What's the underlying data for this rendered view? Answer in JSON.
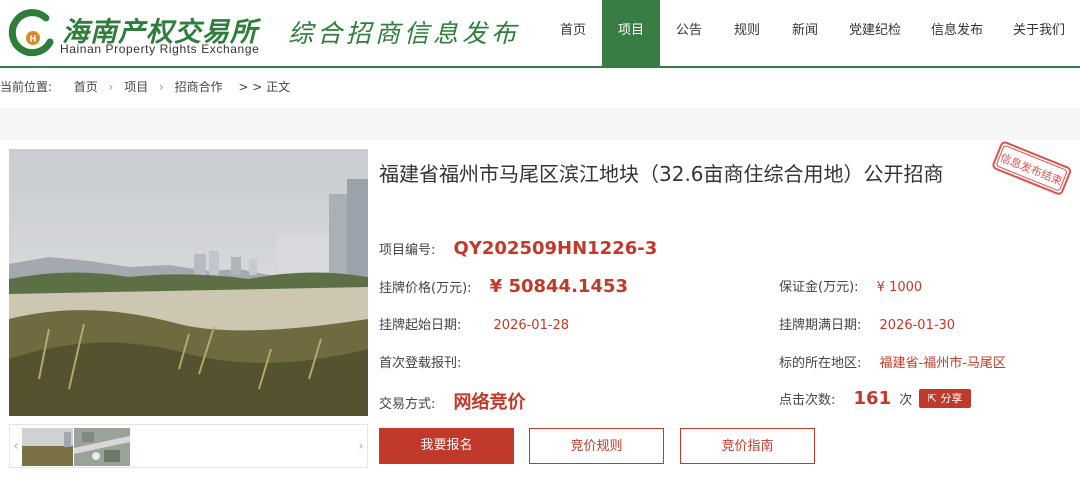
{
  "header": {
    "logo_cn": "海南产权交易所",
    "logo_en": "Hainan Property Rights Exchange",
    "slogan": "综合招商信息发布",
    "nav": [
      "首页",
      "项目",
      "公告",
      "规则",
      "新闻",
      "党建纪检",
      "信息发布",
      "关于我们"
    ],
    "nav_active_index": 1
  },
  "breadcrumb": {
    "prefix": "当前位置:",
    "items": [
      "首页",
      "项目",
      "招商合作"
    ],
    "tail": "> > 正文"
  },
  "project": {
    "title": "福建省福州市马尾区滨江地块（32.6亩商住综合用地）公开招商",
    "stamp_text": "信息发布结束",
    "code_label": "项目编号:",
    "code_value": "QY202509HN1226-3",
    "price_label": "挂牌价格(万元):",
    "price_value": "¥  50844.1453",
    "deposit_label": "保证金(万元):",
    "deposit_value": "¥ 1000",
    "start_label": "挂牌起始日期:",
    "start_value": "2026-01-28",
    "end_label": "挂牌期满日期:",
    "end_value": "2026-01-30",
    "first_pub_label": "首次登载报刊:",
    "first_pub_value": "",
    "region_label": "标的所在地区:",
    "region_value": "福建省-福州市-马尾区",
    "method_label": "交易方式:",
    "method_value": "网络竞价",
    "clicks_label": "点击次数:",
    "clicks_value": "161",
    "clicks_unit": "次",
    "share_label": "分享"
  },
  "buttons": {
    "signup": "我要报名",
    "rules": "竞价规则",
    "guide": "竞价指南"
  },
  "colors": {
    "brand_green": "#3a7d44",
    "accent_red": "#c0392b"
  }
}
